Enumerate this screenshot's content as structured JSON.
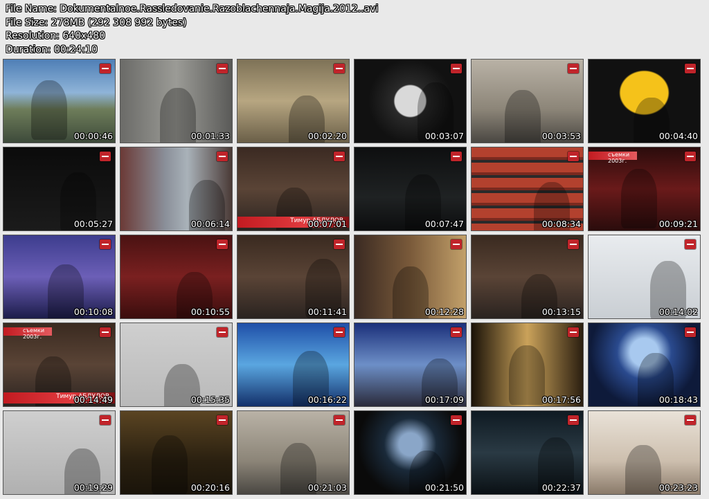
{
  "header": {
    "file_name": "File Name: Dokumentalnoe.Rassledovanie.Razoblachennaja.Magija.2012..avi",
    "file_size": "File Size: 278MB (292 308 992 bytes)",
    "resolution": "Resolution: 640x480",
    "duration": "Duration: 00:24:10"
  },
  "thumbnails": [
    {
      "time": "00:00:46",
      "bg": "linear-gradient(180deg,#4f7fb6 0%,#8fb4d8 40%,#6e7d5a 60%,#3d4a3a 100%)"
    },
    {
      "time": "00:01:33",
      "bg": "linear-gradient(90deg,#6b6b68,#9b9b96 50%,#5a5a58)"
    },
    {
      "time": "00:02:20",
      "bg": "linear-gradient(180deg,#7e7257,#b7a681 50%,#6a5f48)"
    },
    {
      "time": "00:03:07",
      "bg": "radial-gradient(circle at 50% 50%,#d9d9d9 0 22%,#2a2a2a 24%,#111 60%)"
    },
    {
      "time": "00:03:53",
      "bg": "linear-gradient(180deg,#b9b2a6,#8c8578 60%,#4a4742)"
    },
    {
      "time": "00:04:40",
      "bg": "radial-gradient(ellipse at 50% 40%,#f5c21a 0 30%,#111 32%)"
    },
    {
      "time": "00:05:27",
      "bg": "linear-gradient(180deg,#0b0b0b,#1b1b1b)"
    },
    {
      "time": "00:06:14",
      "bg": "linear-gradient(90deg,#6b3a36,#8a8f99 40%,#a9b2b9 60%,#4a3a36)"
    },
    {
      "time": "00:07:01",
      "bg": "linear-gradient(180deg,#3b2a22,#5a4436 50%,#2a2320)",
      "caption": "Тимур АБДУЛОВ"
    },
    {
      "time": "00:07:47",
      "bg": "linear-gradient(180deg,#0e0f10,#1f2223 60%,#0c0d0e)"
    },
    {
      "time": "00:08:34",
      "bg": "repeating-linear-gradient(180deg,#b3412e 0 14px,#7a2a1f 14px 18px,#2a2a2a 18px 22px)"
    },
    {
      "time": "00:09:21",
      "bg": "linear-gradient(180deg,#2b0c0c,#6a1a1a 50%,#2a0c0c)",
      "tag": "съемки 2003г."
    },
    {
      "time": "00:10:08",
      "bg": "linear-gradient(180deg,#3d3d8e,#6c5fb7 50%,#1c1c4a)"
    },
    {
      "time": "00:10:55",
      "bg": "linear-gradient(180deg,#4a1212,#7a2020 50%,#3a0d0d)"
    },
    {
      "time": "00:11:41",
      "bg": "linear-gradient(180deg,#3a2a20,#5a4436 50%,#2a2320)"
    },
    {
      "time": "00:12:28",
      "bg": "linear-gradient(90deg,#3a2a22,#7a5a3a 50%,#c2a06a)"
    },
    {
      "time": "00:13:15",
      "bg": "linear-gradient(180deg,#3a2a20,#5a4436 50%,#2a2320)"
    },
    {
      "time": "00:14:02",
      "bg": "linear-gradient(180deg,#e9ecef,#c9ced3)"
    },
    {
      "time": "00:14:49",
      "bg": "linear-gradient(180deg,#3a2a20,#5a4436 50%,#2a2320)",
      "tag": "съемки 2003г.",
      "caption": "Тимур АБДУЛОВ"
    },
    {
      "time": "00:15:35",
      "bg": "linear-gradient(180deg,#cfcfcf,#b9b9b9)"
    },
    {
      "time": "00:16:22",
      "bg": "linear-gradient(180deg,#1f4fa8,#5aa6e0 50%,#13306a)"
    },
    {
      "time": "00:17:09",
      "bg": "linear-gradient(180deg,#1b2f7a,#6d8fc7 50%,#2a2a3a)"
    },
    {
      "time": "00:17:56",
      "bg": "linear-gradient(90deg,#1a1208,#caa25a 50%,#2a1e10)"
    },
    {
      "time": "00:18:43",
      "bg": "radial-gradient(circle at 50% 35%,#a8c9ef 0 18%,#2a4a8e 35%,#0e1a3a 70%)"
    },
    {
      "time": "00:19:29",
      "bg": "linear-gradient(180deg,#cfcfcf,#b0b0b0)"
    },
    {
      "time": "00:20:16",
      "bg": "linear-gradient(180deg,#5a4422,#2a2010 60%,#1a140a)"
    },
    {
      "time": "00:21:03",
      "bg": "linear-gradient(180deg,#b9b2a6,#8c8578 60%,#4a4742)"
    },
    {
      "time": "00:21:50",
      "bg": "radial-gradient(circle at 50% 40%,#8aa6c8 0 15%,#1a2a3a 35%,#0a0a0a 70%)"
    },
    {
      "time": "00:22:37",
      "bg": "linear-gradient(180deg,#0f1a22,#2a3a44 50%,#0a1014)"
    },
    {
      "time": "00:23:23",
      "bg": "linear-gradient(180deg,#e9e2d8,#cdbfae 60%,#8a7a6a)"
    }
  ]
}
